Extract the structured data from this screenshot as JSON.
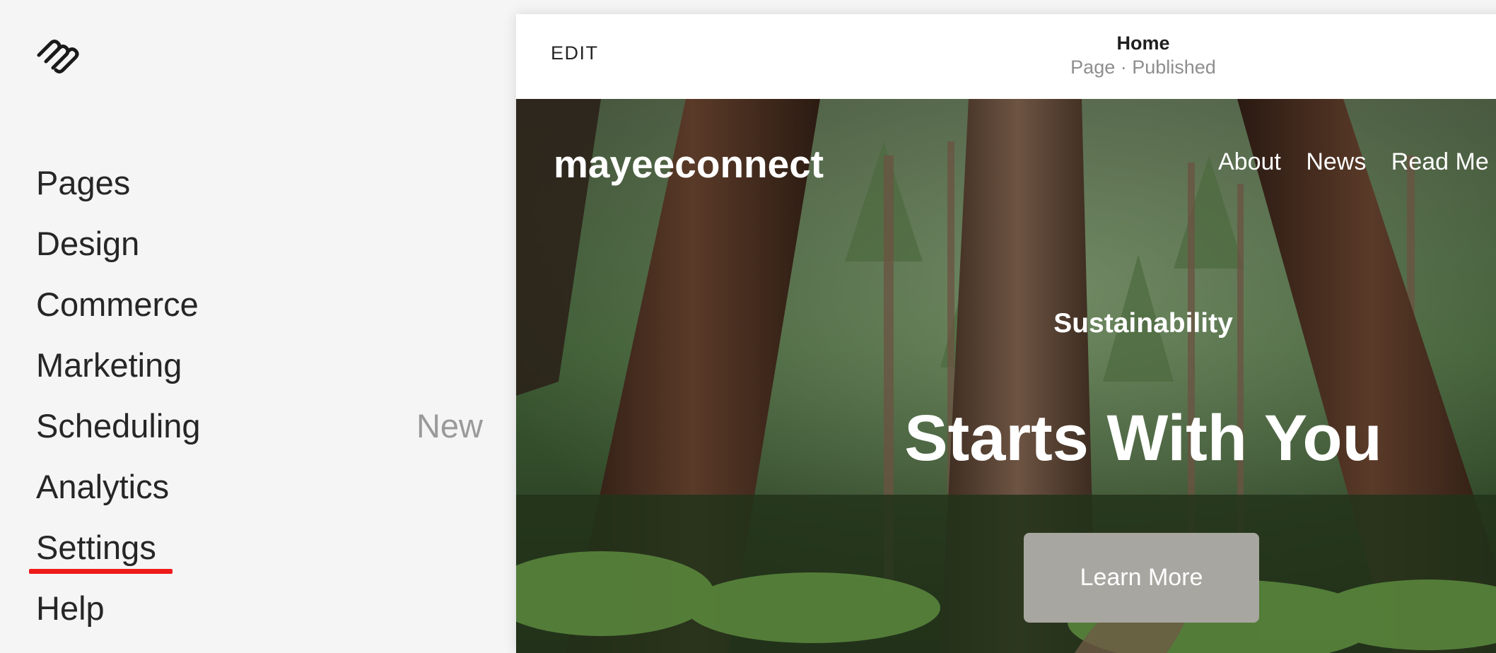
{
  "app": {
    "logo_icon": "squarespace-logo-icon",
    "accent_color": "#ee1b1b"
  },
  "sidebar": {
    "items": [
      {
        "label": "Pages",
        "badge": ""
      },
      {
        "label": "Design",
        "badge": ""
      },
      {
        "label": "Commerce",
        "badge": ""
      },
      {
        "label": "Marketing",
        "badge": ""
      },
      {
        "label": "Scheduling",
        "badge": "New"
      },
      {
        "label": "Analytics",
        "badge": ""
      },
      {
        "label": "Settings",
        "badge": ""
      },
      {
        "label": "Help",
        "badge": ""
      }
    ]
  },
  "editor": {
    "edit_label": "EDIT",
    "page_title": "Home",
    "page_status": "Page · Published"
  },
  "preview": {
    "site_title": "mayeeconnect",
    "nav": [
      "About",
      "News",
      "Read Me"
    ],
    "hero_kicker": "Sustainability",
    "hero_title": "Starts With You",
    "hero_button": "Learn More",
    "hero_button_color": "#a8a6a0"
  }
}
